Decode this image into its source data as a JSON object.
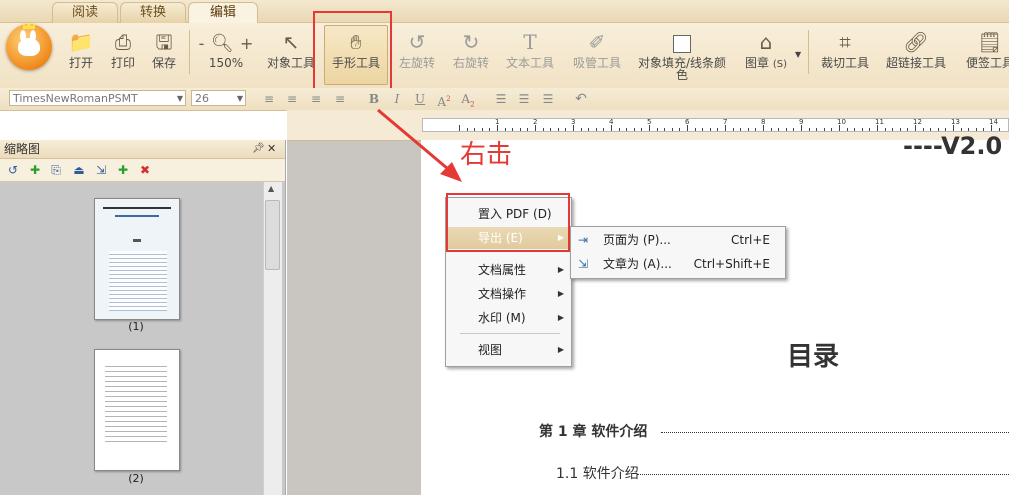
{
  "tabs": [
    {
      "label": "阅读",
      "active": false
    },
    {
      "label": "转换",
      "active": false
    },
    {
      "label": "编辑",
      "active": true
    }
  ],
  "toolbar": {
    "open": "打开",
    "print": "打印",
    "save": "保存",
    "zoom": "150%",
    "zoom_minus": "-",
    "zoom_plus": "+",
    "object_tool": "对象工具",
    "hand_tool": "手形工具",
    "rotate_left": "左旋转",
    "rotate_right": "右旋转",
    "text_tool": "文本工具",
    "eyedropper": "吸管工具",
    "fill_line1": "对象填充/线条颜",
    "fill_line2": "色",
    "stamp": "图章",
    "stamp_shortcut": "(S)",
    "crop": "裁切工具",
    "hyperlink": "超链接工具",
    "note": "便签工具"
  },
  "format": {
    "font": "TimesNewRomanPSMT",
    "size": "26"
  },
  "annotation": {
    "right_click": "右击"
  },
  "thumbnails": {
    "title": "缩略图",
    "pin": "ᵖ",
    "close": "✕",
    "pages": [
      {
        "label": "(1)"
      },
      {
        "label": "(2)"
      }
    ]
  },
  "document": {
    "header_fragment": "----V2.0",
    "toc_title": "目录",
    "chapter1": "第 1 章  软件介绍",
    "section1_1": "1.1 软件介绍"
  },
  "context_menu": {
    "items": [
      {
        "label": "置入 PDF (D)",
        "submenu": false
      },
      {
        "label": "导出 (E)",
        "submenu": true
      },
      {
        "label": "文档属性",
        "submenu": true
      },
      {
        "label": "文档操作",
        "submenu": true
      },
      {
        "label": "水印 (M)",
        "submenu": true
      },
      {
        "label": "视图",
        "submenu": true
      }
    ]
  },
  "export_submenu": {
    "items": [
      {
        "label": "页面为 (P)...",
        "shortcut": "Ctrl+E"
      },
      {
        "label": "文章为 (A)...",
        "shortcut": "Ctrl+Shift+E"
      }
    ]
  },
  "colors": {
    "accent": "#e53935",
    "ribbon": "#f1e2c4",
    "menu_selected": "#e1cb9c"
  }
}
